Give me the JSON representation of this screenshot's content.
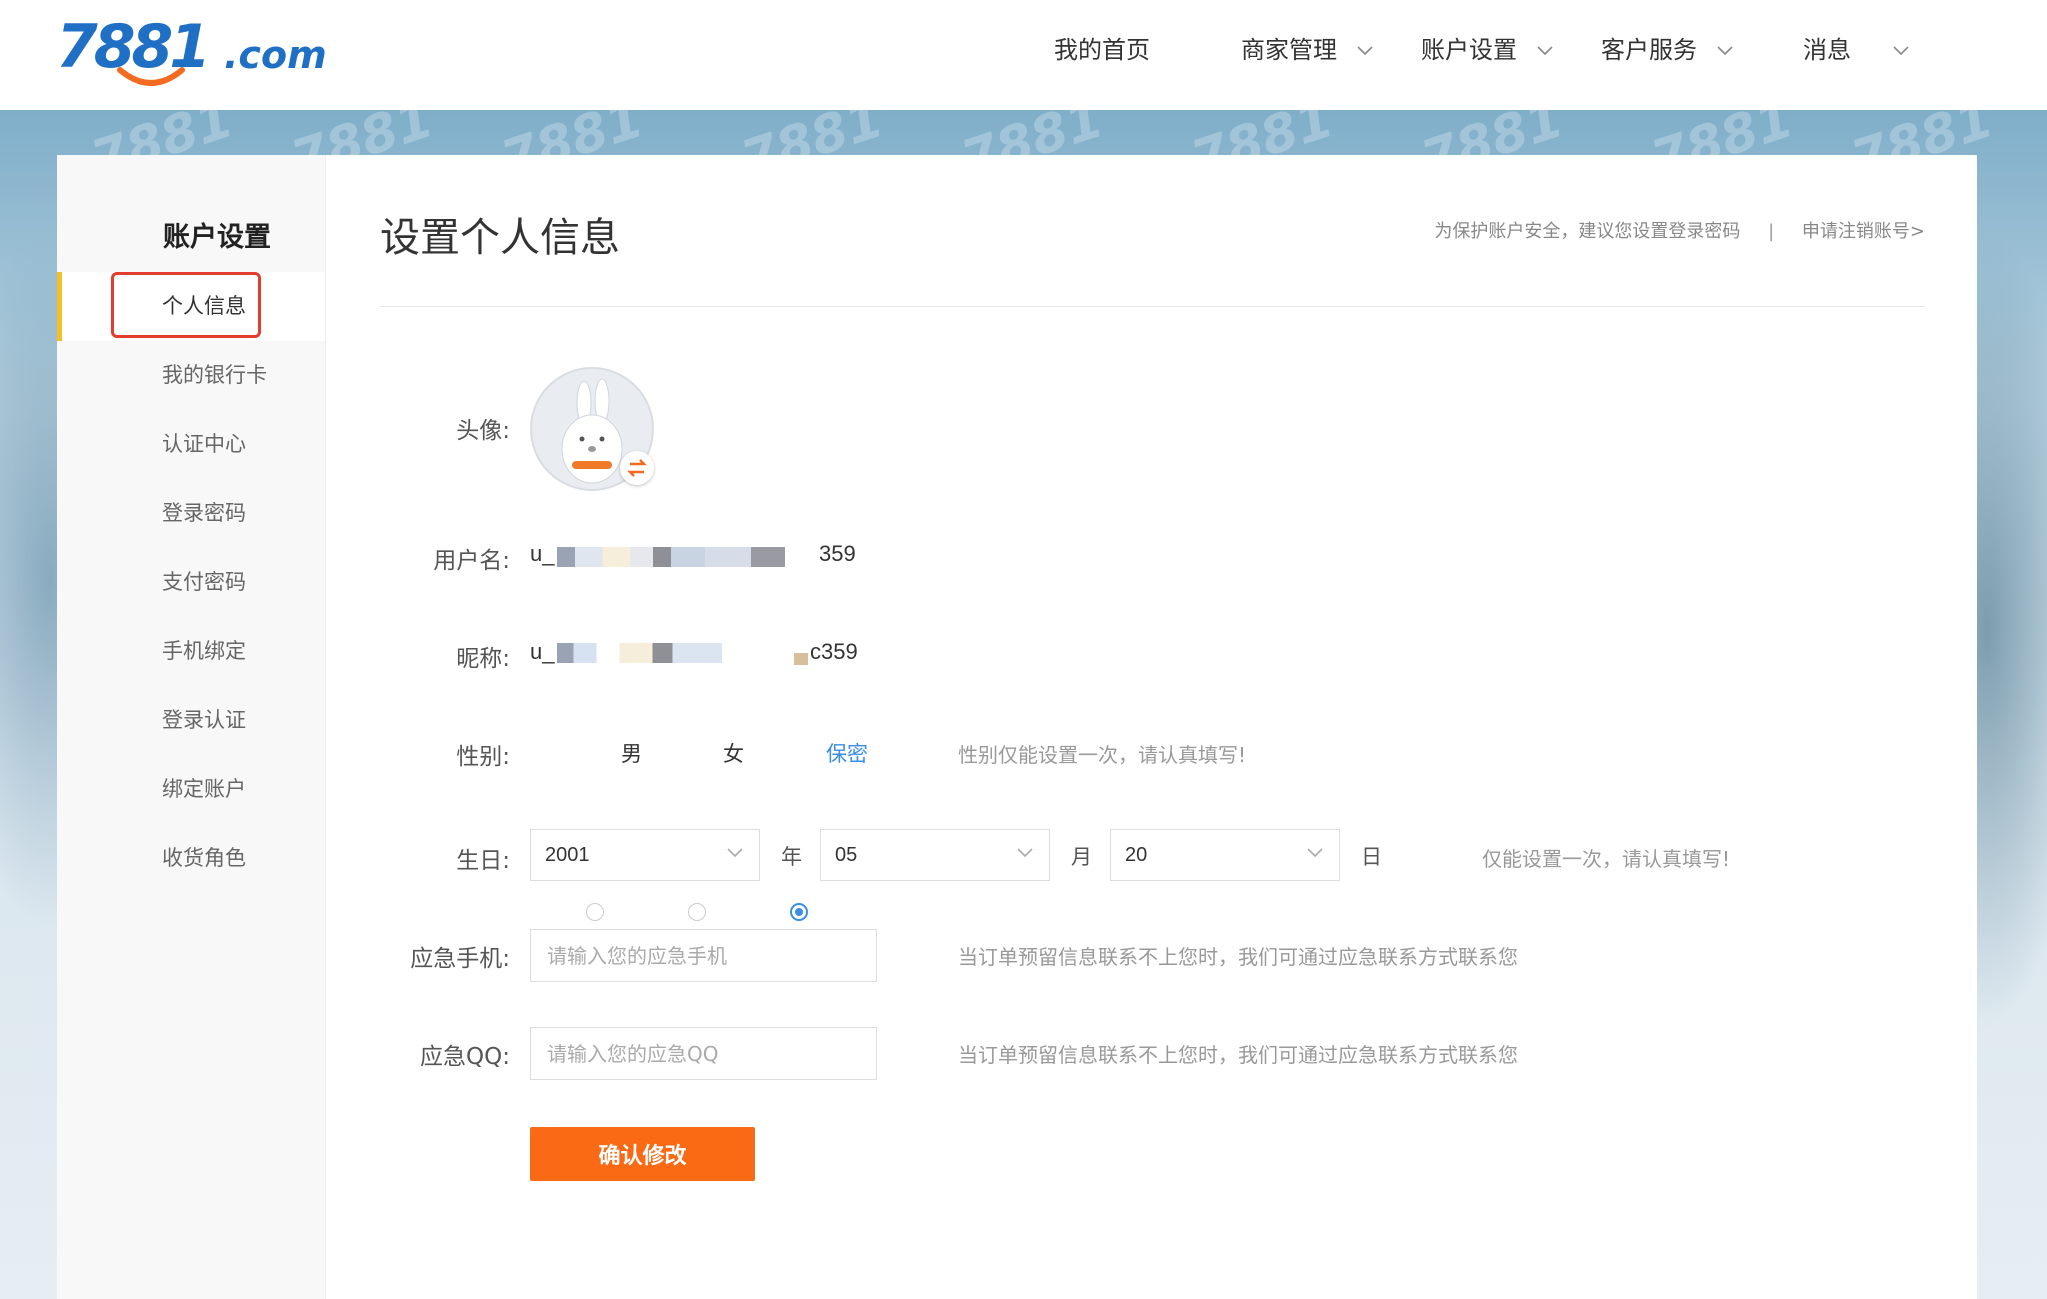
{
  "logo": {
    "number": "7881",
    "domain": ".com"
  },
  "nav": {
    "home": "我的首页",
    "merchant": "商家管理",
    "account": "账户设置",
    "service": "客户服务",
    "messages": "消息"
  },
  "sidebar": {
    "title": "账户设置",
    "items": [
      {
        "label": "个人信息"
      },
      {
        "label": "我的银行卡"
      },
      {
        "label": "认证中心"
      },
      {
        "label": "登录密码"
      },
      {
        "label": "支付密码"
      },
      {
        "label": "手机绑定"
      },
      {
        "label": "登录认证"
      },
      {
        "label": "绑定账户"
      },
      {
        "label": "收货角色"
      }
    ]
  },
  "colors": {
    "accent": "#fa6a14",
    "brand": "#1f6fc4",
    "active_marker": "#f5c024",
    "highlight": "#e33d2d",
    "radio": "#3a8ee6"
  },
  "main": {
    "title": "设置个人信息",
    "security_tip": "为保护账户安全，建议您设置登录密码",
    "separator": "|",
    "cancel_account": "申请注销账号>",
    "avatar_label": "头像:",
    "username_label": "用户名:",
    "username_prefix": "u_",
    "username_suffix": "359",
    "nickname_label": "昵称:",
    "nickname_prefix": "u_",
    "nickname_suffix": "c359",
    "gender_label": "性别:",
    "gender_options": [
      "男",
      "女",
      "保密"
    ],
    "gender_selected": "保密",
    "gender_hint": "性别仅能设置一次，请认真填写!",
    "birthday_label": "生日:",
    "birth_year": "2001",
    "birth_year_unit": "年",
    "birth_month": "05",
    "birth_month_unit": "月",
    "birth_day": "20",
    "birth_day_unit": "日",
    "birthday_hint": "仅能设置一次，请认真填写!",
    "phone_label": "应急手机:",
    "phone_placeholder": "请输入您的应急手机",
    "phone_hint": "当订单预留信息联系不上您时，我们可通过应急联系方式联系您",
    "qq_label": "应急QQ:",
    "qq_placeholder": "请输入您的应急QQ",
    "qq_hint": "当订单预留信息联系不上您时，我们可通过应急联系方式联系您",
    "submit": "确认修改"
  }
}
